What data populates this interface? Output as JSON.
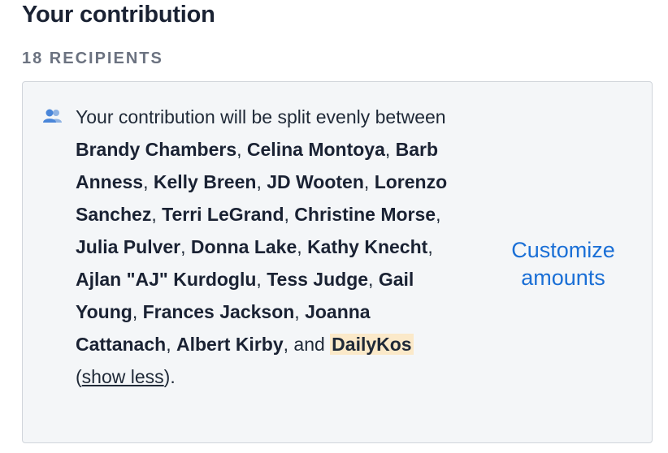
{
  "header": {
    "title": "Your contribution",
    "subtitle": "18 RECIPIENTS"
  },
  "split": {
    "icon": "people-icon",
    "intro": "Your contribution will be split evenly between ",
    "recipients": [
      "Brandy Chambers",
      "Celina Montoya",
      "Barb Anness",
      "Kelly Breen",
      "JD Wooten",
      "Lorenzo Sanchez",
      "Terri LeGrand",
      "Christine Morse",
      "Julia Pulver",
      "Donna Lake",
      "Kathy Knecht",
      "Ajlan \"AJ\" Kurdoglu",
      "Tess Judge",
      "Gail Young",
      "Frances Jackson",
      "Joanna Cattanach",
      "Albert Kirby"
    ],
    "and_text": "and",
    "highlight": "DailyKos",
    "toggle_label": "show less",
    "highlight_color": "#fbe9c9"
  },
  "customize": {
    "label": "Customize amounts",
    "color": "#1a6fd6"
  }
}
